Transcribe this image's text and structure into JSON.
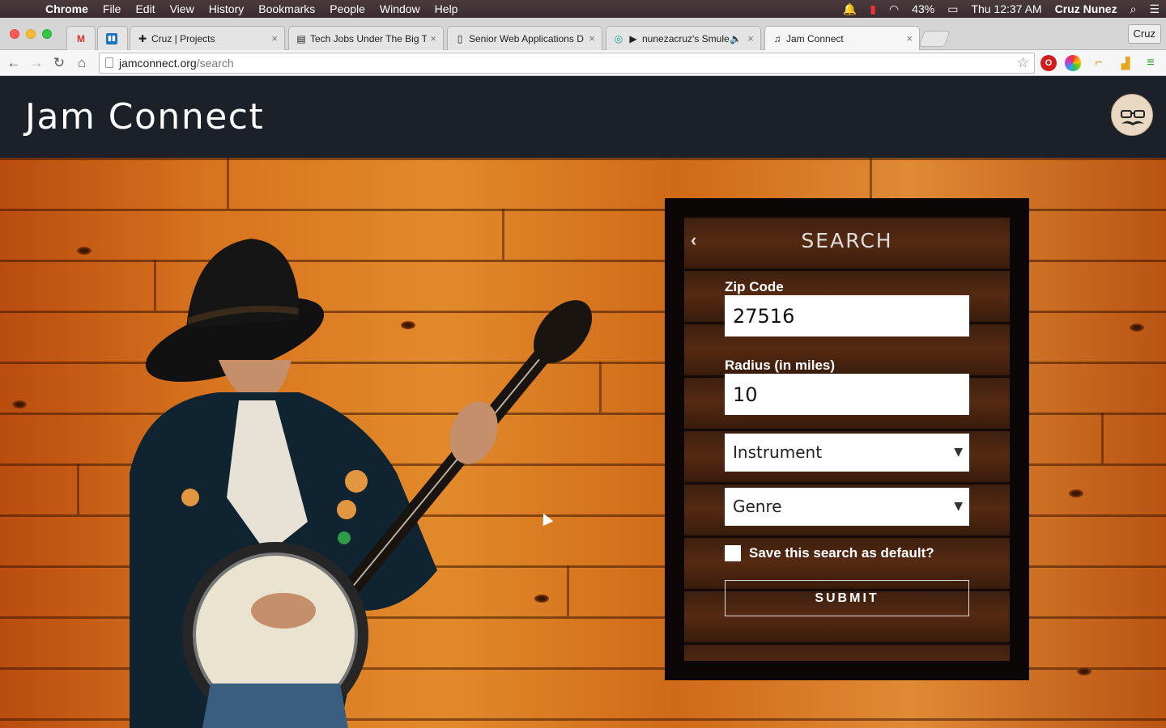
{
  "menubar": {
    "app": "Chrome",
    "items": [
      "File",
      "Edit",
      "View",
      "History",
      "Bookmarks",
      "People",
      "Window",
      "Help"
    ],
    "battery": "43%",
    "clock": "Thu 12:37 AM",
    "user": "Cruz Nunez"
  },
  "tabs": [
    {
      "title": "",
      "icon": "gmail-icon"
    },
    {
      "title": "",
      "icon": "trello-icon"
    },
    {
      "title": "Cruz | Projects",
      "icon": "plus-icon"
    },
    {
      "title": "Tech Jobs Under The Big T",
      "icon": "page-icon"
    },
    {
      "title": "Senior Web Applications D",
      "icon": "doc-icon"
    },
    {
      "title": "nunezacruz's Smule",
      "icon": "smule-icon"
    },
    {
      "title": "Jam Connect",
      "icon": "music-note-icon"
    }
  ],
  "profile_button": "Cruz",
  "omnibox": {
    "host": "jamconnect.org",
    "path": "/search"
  },
  "app": {
    "brand": "Jam Connect"
  },
  "search": {
    "title": "SEARCH",
    "zip_label": "Zip Code",
    "zip_value": "27516",
    "radius_label": "Radius (in miles)",
    "radius_value": "10",
    "instrument_placeholder": "Instrument",
    "genre_placeholder": "Genre",
    "save_default_label": "Save this search as default?",
    "save_default_checked": false,
    "submit_label": "SUBMIT"
  },
  "colors": {
    "header_bg": "#1c2028",
    "panel_border": "#0a0706",
    "wood": "#d8741f"
  }
}
